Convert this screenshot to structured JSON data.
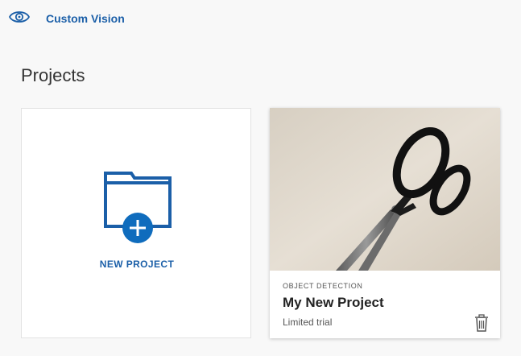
{
  "header": {
    "app_title": "Custom Vision",
    "logo_icon": "eye-icon"
  },
  "page": {
    "title": "Projects"
  },
  "new_project": {
    "label": "NEW PROJECT",
    "icon": "folder-add-icon"
  },
  "projects": [
    {
      "type": "OBJECT DETECTION",
      "name": "My New Project",
      "status": "Limited trial",
      "thumbnail": "scissors-photo",
      "delete_icon": "trash-icon"
    }
  ],
  "colors": {
    "accent": "#1b5fa8",
    "primary_button": "#0f6cbd",
    "background": "#f8f8f8"
  }
}
